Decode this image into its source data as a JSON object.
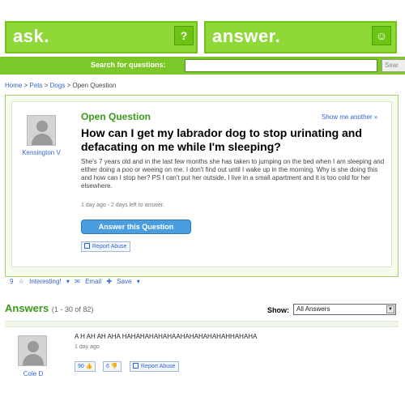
{
  "header": {
    "ask_label": "ask.",
    "answer_label": "answer.",
    "ask_mascot": "?",
    "answer_mascot": "☺",
    "search_label": "Search for questions:",
    "search_button": "Sear"
  },
  "breadcrumb": {
    "items": [
      "Home",
      "Pets",
      "Dogs"
    ],
    "current": "Open Question",
    "separator": ">"
  },
  "question": {
    "status": "Open Question",
    "show_another": "Show me another »",
    "user": "Kensington V",
    "title": "How can I get my labrador dog to stop urinating and defacating on me while I'm sleeping?",
    "body": "She's 7 years old and in the last few months she has taken to jumping on the bed when I am sleeping and either doing a poo or weeing on me. I don't find out until I wake up in the morning. Why is she doing this and how can I stop her? PS I can't put her outside, I live in a small apartment and it is too cold for her elsewhere.",
    "meta": "1 day ago - 2 days left to answer.",
    "answer_button": "Answer this Question",
    "report": "Report Abuse"
  },
  "actions": {
    "interesting_count": "9",
    "interesting": "Interesting!",
    "email": "Email",
    "save": "Save"
  },
  "answers": {
    "heading": "Answers",
    "count": "(1 - 30 of 82)",
    "show_label": "Show:",
    "show_value": "All Answers",
    "items": [
      {
        "user": "Cole D",
        "text": "A H AH AH AHA HAHAHAHAHAHAAHAHAHAHAHAHHAHAHA",
        "time": "1 day ago",
        "up": "90",
        "down": "6",
        "report": "Report Abuse"
      }
    ]
  },
  "colors": {
    "brand_green": "#8ed838",
    "bar_green": "#7dc829",
    "link_blue": "#3366cc",
    "answer_button_blue": "#4a9ee0"
  }
}
